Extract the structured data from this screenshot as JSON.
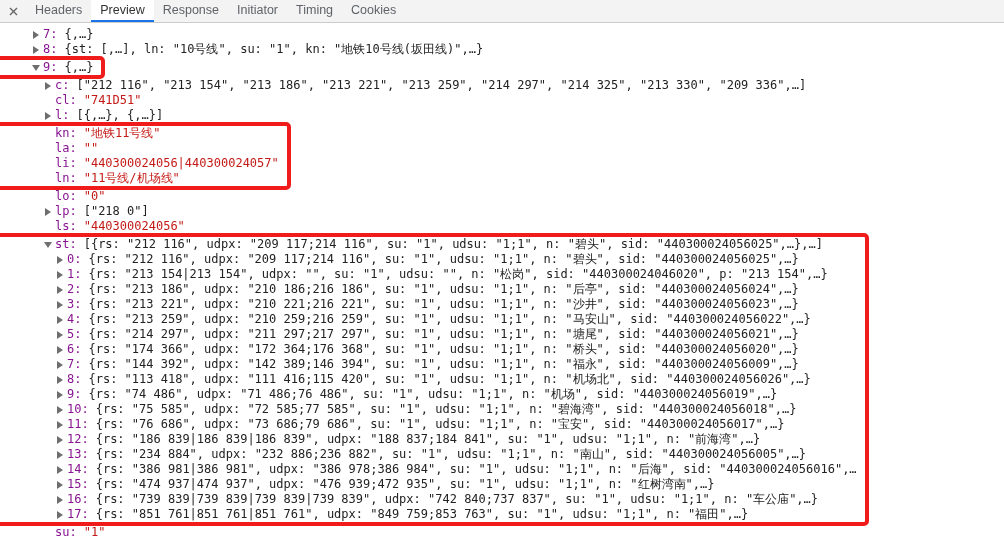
{
  "tabs": [
    {
      "label": "Headers",
      "selected": false
    },
    {
      "label": "Preview",
      "selected": true
    },
    {
      "label": "Response",
      "selected": false
    },
    {
      "label": "Initiator",
      "selected": false
    },
    {
      "label": "Timing",
      "selected": false
    },
    {
      "label": "Cookies",
      "selected": false
    }
  ],
  "rows": [
    {
      "key": "7:",
      "value": "{,…}",
      "kind": "preview",
      "expanded": false,
      "highlighted": false
    },
    {
      "key": "8:",
      "value": "{st: [,…], ln: \"10号线\", su: \"1\", kn: \"地铁10号线(坂田线)\",…}",
      "kind": "preview",
      "expanded": false,
      "highlighted": false
    },
    {
      "key": "9:",
      "value": "{,…}",
      "kind": "preview",
      "expanded": true,
      "highlighted": true,
      "children": [
        {
          "key": "c:",
          "value": "[\"212 116\", \"213 154\", \"213 186\", \"213 221\", \"213 259\", \"214 297\", \"214 325\", \"213 330\", \"209 336\",…]",
          "kind": "preview",
          "expanded": false,
          "highlighted": false
        },
        {
          "key": "cl:",
          "value": "\"741D51\"",
          "kind": "string",
          "highlighted": false
        },
        {
          "key": "l:",
          "value": "[{,…}, {,…}]",
          "kind": "preview",
          "expanded": false,
          "highlighted": false
        },
        {
          "key": "kn:",
          "value": "\"地铁11号线\"",
          "kind": "string",
          "highlighted": true
        },
        {
          "key": "la:",
          "value": "\"\"",
          "kind": "string",
          "highlighted": true
        },
        {
          "key": "li:",
          "value": "\"440300024056|440300024057\"",
          "kind": "string",
          "highlighted": true
        },
        {
          "key": "ln:",
          "value": "\"11号线/机场线\"",
          "kind": "string",
          "highlighted": true
        },
        {
          "key": "lo:",
          "value": "\"0\"",
          "kind": "string",
          "highlighted": false
        },
        {
          "key": "lp:",
          "value": "[\"218 0\"]",
          "kind": "preview",
          "expanded": false,
          "highlighted": false
        },
        {
          "key": "ls:",
          "value": "\"440300024056\"",
          "kind": "string",
          "highlighted": false
        },
        {
          "key": "st:",
          "value": "[{rs: \"212 116\", udpx: \"209 117;214 116\", su: \"1\", udsu: \"1;1\", n: \"碧头\", sid: \"440300024056025\",…},…]",
          "kind": "preview",
          "expanded": true,
          "highlighted": true,
          "children": [
            {
              "key": "0:",
              "value": "{rs: \"212 116\", udpx: \"209 117;214 116\", su: \"1\", udsu: \"1;1\", n: \"碧头\", sid: \"440300024056025\",…}",
              "kind": "preview",
              "expanded": false
            },
            {
              "key": "1:",
              "value": "{rs: \"213 154|213 154\", udpx: \"\", su: \"1\", udsu: \"\", n: \"松岗\", sid: \"440300024046020\", p: \"213 154\",…}",
              "kind": "preview",
              "expanded": false
            },
            {
              "key": "2:",
              "value": "{rs: \"213 186\", udpx: \"210 186;216 186\", su: \"1\", udsu: \"1;1\", n: \"后亭\", sid: \"440300024056024\",…}",
              "kind": "preview",
              "expanded": false
            },
            {
              "key": "3:",
              "value": "{rs: \"213 221\", udpx: \"210 221;216 221\", su: \"1\", udsu: \"1;1\", n: \"沙井\", sid: \"440300024056023\",…}",
              "kind": "preview",
              "expanded": false
            },
            {
              "key": "4:",
              "value": "{rs: \"213 259\", udpx: \"210 259;216 259\", su: \"1\", udsu: \"1;1\", n: \"马安山\", sid: \"440300024056022\",…}",
              "kind": "preview",
              "expanded": false
            },
            {
              "key": "5:",
              "value": "{rs: \"214 297\", udpx: \"211 297;217 297\", su: \"1\", udsu: \"1;1\", n: \"塘尾\", sid: \"440300024056021\",…}",
              "kind": "preview",
              "expanded": false
            },
            {
              "key": "6:",
              "value": "{rs: \"174 366\", udpx: \"172 364;176 368\", su: \"1\", udsu: \"1;1\", n: \"桥头\", sid: \"440300024056020\",…}",
              "kind": "preview",
              "expanded": false
            },
            {
              "key": "7:",
              "value": "{rs: \"144 392\", udpx: \"142 389;146 394\", su: \"1\", udsu: \"1;1\", n: \"福永\", sid: \"440300024056009\",…}",
              "kind": "preview",
              "expanded": false
            },
            {
              "key": "8:",
              "value": "{rs: \"113 418\", udpx: \"111 416;115 420\", su: \"1\", udsu: \"1;1\", n: \"机场北\", sid: \"440300024056026\",…}",
              "kind": "preview",
              "expanded": false
            },
            {
              "key": "9:",
              "value": "{rs: \"74 486\", udpx: \"71 486;76 486\", su: \"1\", udsu: \"1;1\", n: \"机场\", sid: \"440300024056019\",…}",
              "kind": "preview",
              "expanded": false
            },
            {
              "key": "10:",
              "value": "{rs: \"75 585\", udpx: \"72 585;77 585\", su: \"1\", udsu: \"1;1\", n: \"碧海湾\", sid: \"440300024056018\",…}",
              "kind": "preview",
              "expanded": false
            },
            {
              "key": "11:",
              "value": "{rs: \"76 686\", udpx: \"73 686;79 686\", su: \"1\", udsu: \"1;1\", n: \"宝安\", sid: \"440300024056017\",…}",
              "kind": "preview",
              "expanded": false
            },
            {
              "key": "12:",
              "value": "{rs: \"186 839|186 839|186 839\", udpx: \"188 837;184 841\", su: \"1\", udsu: \"1;1\", n: \"前海湾\",…}",
              "kind": "preview",
              "expanded": false
            },
            {
              "key": "13:",
              "value": "{rs: \"234 884\", udpx: \"232 886;236 882\", su: \"1\", udsu: \"1;1\", n: \"南山\", sid: \"440300024056005\",…}",
              "kind": "preview",
              "expanded": false
            },
            {
              "key": "14:",
              "value": "{rs: \"386 981|386 981\", udpx: \"386 978;386 984\", su: \"1\", udsu: \"1;1\", n: \"后海\", sid: \"440300024056016\",…",
              "kind": "preview",
              "expanded": false
            },
            {
              "key": "15:",
              "value": "{rs: \"474 937|474 937\", udpx: \"476 939;472 935\", su: \"1\", udsu: \"1;1\", n: \"红树湾南\",…}",
              "kind": "preview",
              "expanded": false
            },
            {
              "key": "16:",
              "value": "{rs: \"739 839|739 839|739 839|739 839\", udpx: \"742 840;737 837\", su: \"1\", udsu: \"1;1\", n: \"车公庙\",…}",
              "kind": "preview",
              "expanded": false
            },
            {
              "key": "17:",
              "value": "{rs: \"851 761|851 761|851 761\", udpx: \"849 759;853 763\", su: \"1\", udsu: \"1;1\", n: \"福田\",…}",
              "kind": "preview",
              "expanded": false
            }
          ]
        },
        {
          "key": "su:",
          "value": "\"1\"",
          "kind": "string",
          "highlighted": false
        }
      ]
    }
  ]
}
